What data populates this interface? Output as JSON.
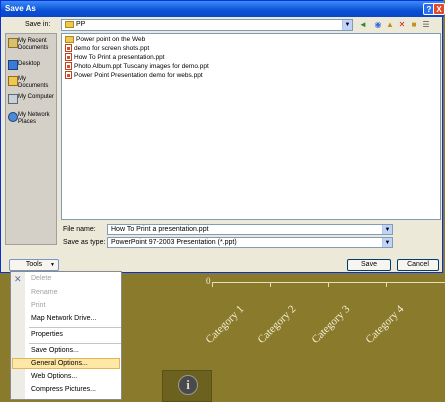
{
  "dialog": {
    "title": "Save As",
    "save_in_label": "Save in:",
    "save_in_value": "PP",
    "places": [
      {
        "label": "My Recent Documents",
        "icon": "recent-documents-icon"
      },
      {
        "label": "Desktop",
        "icon": "desktop-icon"
      },
      {
        "label": "My Documents",
        "icon": "my-documents-icon"
      },
      {
        "label": "My Computer",
        "icon": "my-computer-icon"
      },
      {
        "label": "My Network Places",
        "icon": "network-places-icon"
      }
    ],
    "files": [
      {
        "name": "Power point on the Web",
        "type": "folder"
      },
      {
        "name": "demo for screen shots.ppt",
        "type": "ppt"
      },
      {
        "name": "How To Print a presentation.ppt",
        "type": "ppt"
      },
      {
        "name": "Photo Album.ppt Tuscany images for demo.ppt",
        "type": "ppt"
      },
      {
        "name": "Power Point Presentation demo for webs.ppt",
        "type": "ppt"
      }
    ],
    "file_name_label": "File name:",
    "file_name_value": "How To Print a presentation.ppt",
    "save_type_label": "Save as type:",
    "save_type_value": "PowerPoint 97-2003 Presentation (*.ppt)",
    "tools_label": "Tools",
    "save_label": "Save",
    "cancel_label": "Cancel",
    "help_glyph": "?",
    "close_glyph": "X"
  },
  "menu": {
    "items": [
      {
        "label": "Delete",
        "enabled": false
      },
      {
        "label": "Rename",
        "enabled": false
      },
      {
        "label": "Print",
        "enabled": false
      },
      {
        "label": "Map Network Drive...",
        "enabled": true
      },
      {
        "label": "Properties",
        "enabled": true
      },
      {
        "label": "Save Options...",
        "enabled": true
      },
      {
        "label": "General Options...",
        "enabled": true,
        "highlighted": true
      },
      {
        "label": "Web Options...",
        "enabled": true
      },
      {
        "label": "Compress Pictures...",
        "enabled": true
      }
    ]
  },
  "slide": {
    "axis_zero": "0",
    "categories": [
      "Category 1",
      "Category 2",
      "Category 3",
      "Category 4"
    ],
    "info_glyph": "i"
  },
  "colors": {
    "slide_background": "#8a7a2c",
    "titlebar": "#0a50d6",
    "menu_highlight": "#ffe8a5"
  }
}
